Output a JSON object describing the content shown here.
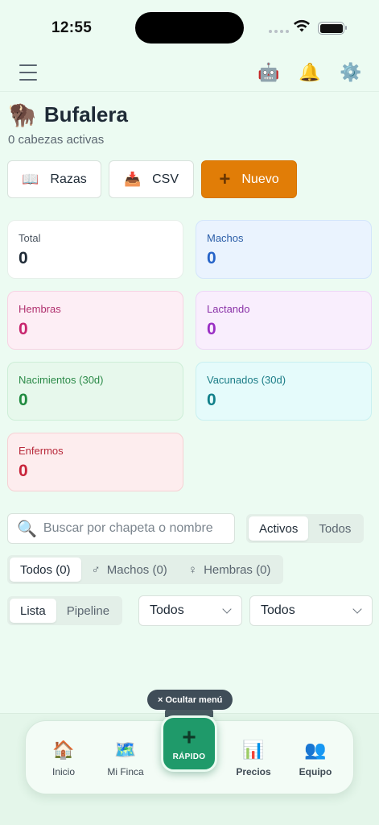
{
  "status_bar": {
    "time": "12:55"
  },
  "header": {
    "title_emoji": "🦬",
    "title": "Bufalera",
    "subtitle": "0 cabezas activas"
  },
  "top_nav": {
    "icons": {
      "assistant": "🤖",
      "notifications": "🔔",
      "settings": "⚙️"
    }
  },
  "actions": {
    "breeds": {
      "icon": "📖",
      "label": "Razas"
    },
    "csv": {
      "icon": "📥",
      "label": "CSV"
    },
    "new": {
      "icon": "+",
      "label": "Nuevo"
    }
  },
  "stats": [
    {
      "label": "Total",
      "value": "0"
    },
    {
      "label": "Machos",
      "value": "0"
    },
    {
      "label": "Hembras",
      "value": "0"
    },
    {
      "label": "Lactando",
      "value": "0"
    },
    {
      "label": "Nacimientos (30d)",
      "value": "0"
    },
    {
      "label": "Vacunados (30d)",
      "value": "0"
    },
    {
      "label": "Enfermos",
      "value": "0"
    }
  ],
  "search": {
    "icon": "🔍",
    "placeholder": "Buscar por chapeta o nombre"
  },
  "status_filter": {
    "options": [
      "Activos",
      "Todos"
    ],
    "selected": "Activos"
  },
  "sex_filter": {
    "options": [
      {
        "symbol": "",
        "label": "Todos (0)"
      },
      {
        "symbol": "♂",
        "label": "Machos (0)"
      },
      {
        "symbol": "♀",
        "label": "Hembras (0)"
      }
    ],
    "selected": "Todos (0)"
  },
  "view_toggle": {
    "options": [
      "Lista",
      "Pipeline"
    ],
    "selected": "Lista"
  },
  "selects": {
    "first": "Todos",
    "second": "Todos"
  },
  "hide_menu": {
    "label": "× Ocultar menú"
  },
  "bottom_nav": {
    "items": [
      {
        "icon": "🏠",
        "label": "Inicio"
      },
      {
        "icon": "🗺️",
        "label": "Mi Finca"
      },
      {
        "icon": "📊",
        "label": "Precios"
      },
      {
        "icon": "👥",
        "label": "Equipo"
      }
    ],
    "fab": {
      "icon": "+",
      "label": "RÁPIDO"
    }
  }
}
